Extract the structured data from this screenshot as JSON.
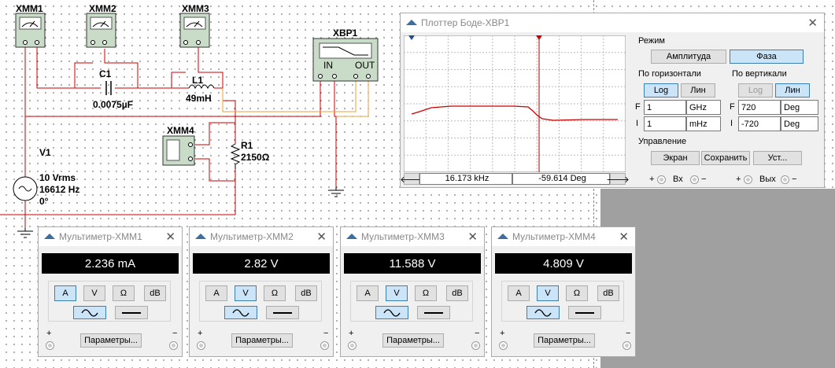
{
  "schematic": {
    "instruments": {
      "xmm1": "XMM1",
      "xmm2": "XMM2",
      "xmm3": "XMM3",
      "xmm4": "XMM4",
      "xbp1": "XBP1"
    },
    "xbp_in": "IN",
    "xbp_out": "OUT",
    "c1": {
      "name": "C1",
      "value": "0.0075µF"
    },
    "l1": {
      "name": "L1",
      "value": "49mH"
    },
    "r1": {
      "name": "R1",
      "value": "2150Ω"
    },
    "v1": {
      "name": "V1",
      "line1": "10 Vrms",
      "line2": "16612 Hz",
      "line3": "0°"
    }
  },
  "bode": {
    "title": "Плоттер Боде-XBP1",
    "mode_label": "Режим",
    "mode_amp": "Амплитуда",
    "mode_phase": "Фаза",
    "horiz_label": "По горизонтали",
    "vert_label": "По вертикали",
    "log": "Log",
    "lin": "Лин",
    "f_label": "F",
    "i_label": "I",
    "h_f_value": "1",
    "h_f_unit": "GHz",
    "h_i_value": "1",
    "h_i_unit": "mHz",
    "v_f_value": "720",
    "v_f_unit": "Deg",
    "v_i_value": "-720",
    "v_i_unit": "Deg",
    "control_label": "Управление",
    "btn_screen": "Экран",
    "btn_save": "Сохранить",
    "btn_set": "Уст...",
    "readout_freq": "16.173 kHz",
    "readout_val": "-59.614 Deg",
    "in_label": "Вх",
    "out_label": "Вых",
    "plus": "+",
    "minus": "−"
  },
  "multimeters": [
    {
      "title": "Мультиметр-XMM1",
      "value": "2.236 mA",
      "mode": "A"
    },
    {
      "title": "Мультиметр-XMM2",
      "value": "2.82 V",
      "mode": "V"
    },
    {
      "title": "Мультиметр-XMM3",
      "value": "11.588 V",
      "mode": "V"
    },
    {
      "title": "Мультиметр-XMM4",
      "value": "4.809 V",
      "mode": "V"
    }
  ],
  "mm_labels": {
    "a": "A",
    "v": "V",
    "ohm": "Ω",
    "db": "dB",
    "params": "Параметры...",
    "plus": "+",
    "minus": "−"
  },
  "colors": {
    "wire": "#cc0000",
    "accent": "#3c7fb1",
    "phase_curve": "#cc0000",
    "selected": "#cce4f7"
  }
}
